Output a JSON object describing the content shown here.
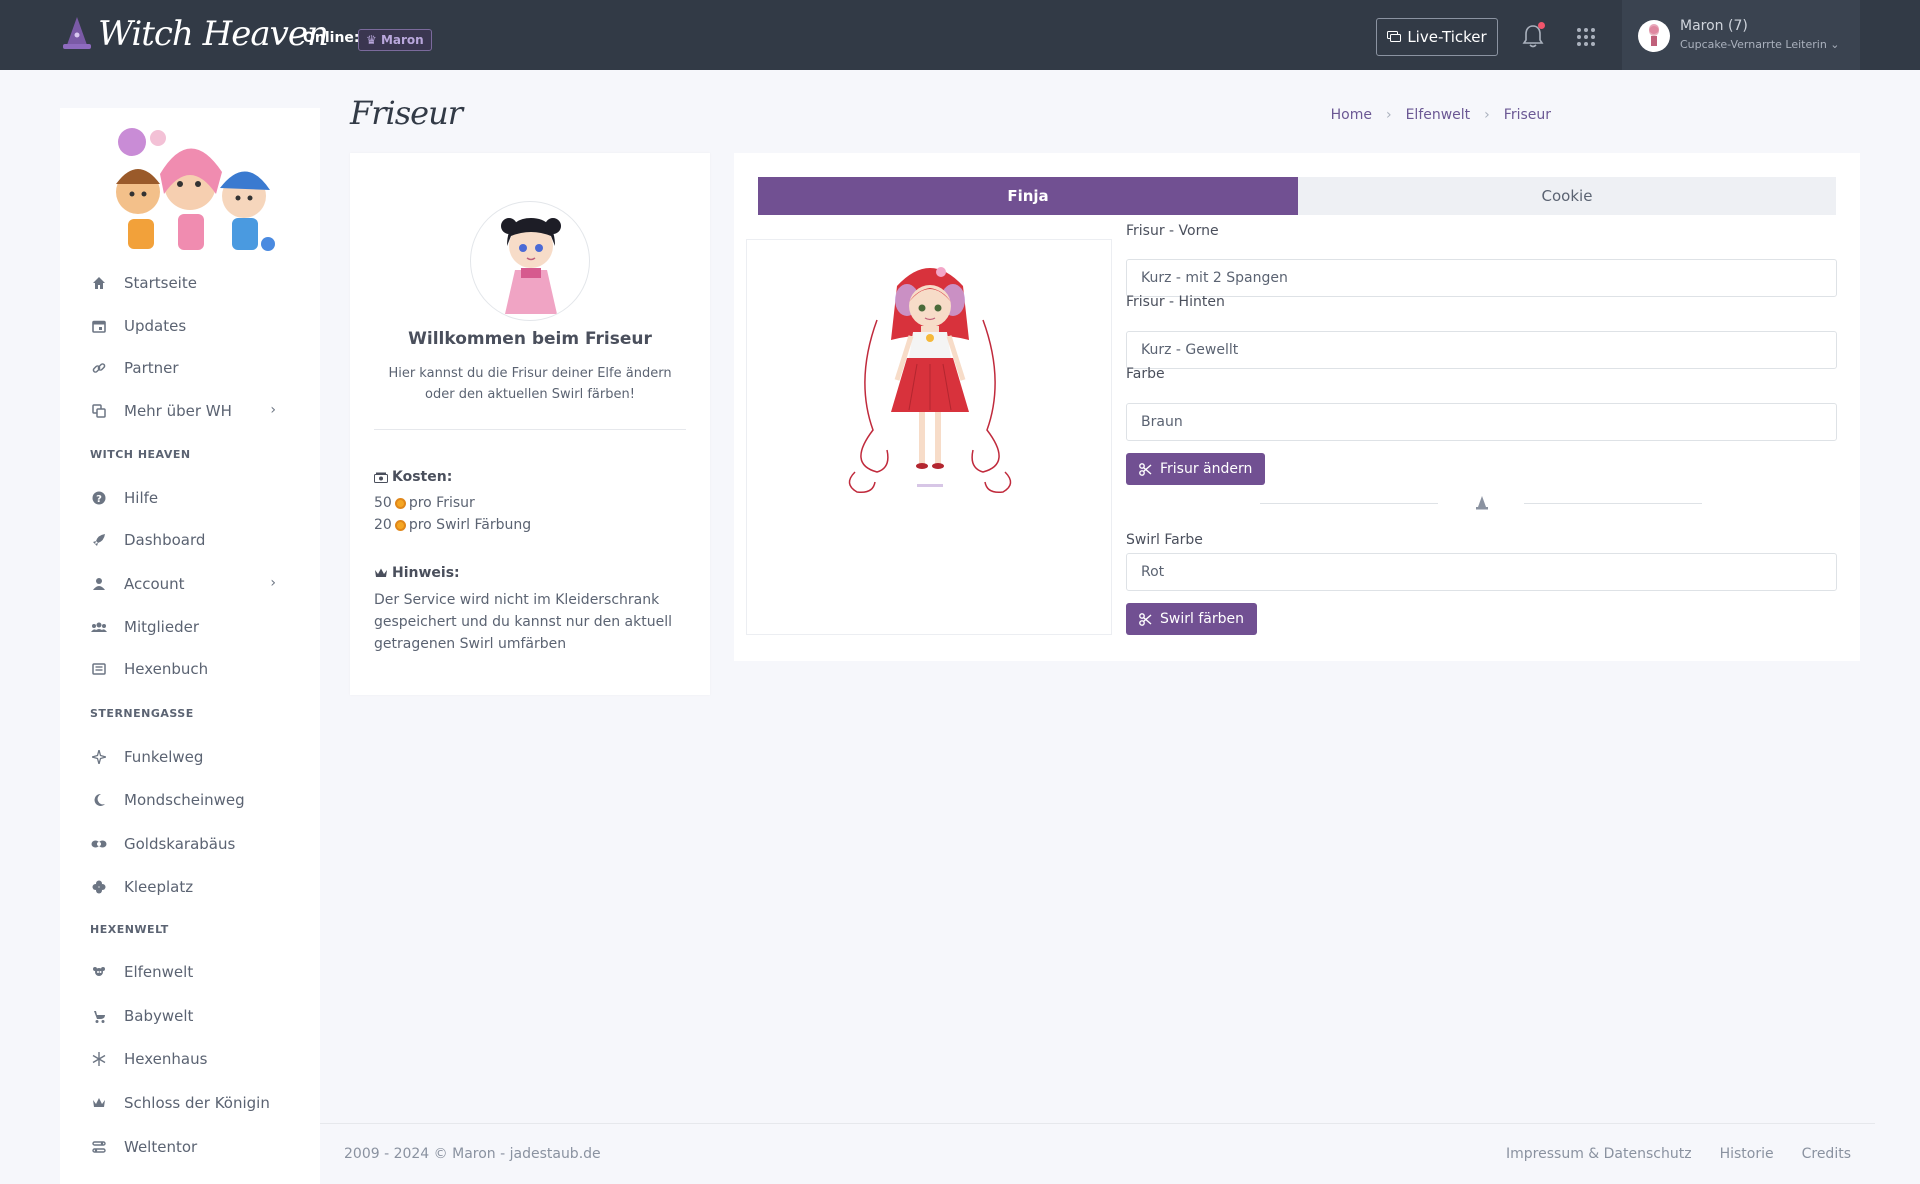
{
  "header": {
    "logo_text": "Witch Heaven",
    "online_label": "Online:",
    "online_user": "Maron",
    "live_ticker_label": "Live-Ticker",
    "user_name": "Maron (7)",
    "user_role": "Cupcake-Vernarrte Leiterin"
  },
  "sidebar": {
    "items_main": [
      {
        "label": "Startseite",
        "icon": "home-icon"
      },
      {
        "label": "Updates",
        "icon": "calendar-icon"
      },
      {
        "label": "Partner",
        "icon": "link-icon"
      },
      {
        "label": "Mehr über WH",
        "icon": "copy-icon"
      }
    ],
    "section_witch_heaven": "WITCH HEAVEN",
    "items_wh": [
      {
        "label": "Hilfe",
        "icon": "help-icon"
      },
      {
        "label": "Dashboard",
        "icon": "rocket-icon"
      },
      {
        "label": "Account",
        "icon": "user-icon"
      },
      {
        "label": "Mitglieder",
        "icon": "users-icon"
      },
      {
        "label": "Hexenbuch",
        "icon": "book-icon"
      }
    ],
    "section_sternengasse": "STERNENGASSE",
    "items_sg": [
      {
        "label": "Funkelweg",
        "icon": "sparkle-icon"
      },
      {
        "label": "Mondscheinweg",
        "icon": "moon-icon"
      },
      {
        "label": "Goldskarabäus",
        "icon": "scarab-icon"
      },
      {
        "label": "Kleeplatz",
        "icon": "clover-icon"
      }
    ],
    "section_hexenwelt": "HEXENWELT",
    "items_hw": [
      {
        "label": "Elfenwelt",
        "icon": "fairy-icon"
      },
      {
        "label": "Babywelt",
        "icon": "stroller-icon"
      },
      {
        "label": "Hexenhaus",
        "icon": "snowflake-icon"
      },
      {
        "label": "Schloss der Königin",
        "icon": "crown-icon"
      },
      {
        "label": "Weltentor",
        "icon": "portal-icon"
      }
    ]
  },
  "page": {
    "title": "Friseur",
    "breadcrumb": [
      "Home",
      "Elfenwelt",
      "Friseur"
    ]
  },
  "info": {
    "welcome_title": "Willkommen beim Friseur",
    "welcome_text": "Hier kannst du die Frisur deiner Elfe ändern oder den aktuellen Swirl färben!",
    "cost_label": "Kosten:",
    "cost_hair_amount": "50",
    "cost_hair_text": "pro Frisur",
    "cost_swirl_amount": "20",
    "cost_swirl_text": "pro Swirl Färbung",
    "hint_label": "Hinweis:",
    "hint_text": "Der Service wird nicht im Kleiderschrank gespeichert und du kannst nur den aktuell getragenen Swirl umfärben"
  },
  "tabs": [
    "Finja",
    "Cookie"
  ],
  "form": {
    "front_label": "Frisur - Vorne",
    "front_value": "Kurz - mit 2 Spangen",
    "back_label": "Frisur - Hinten",
    "back_value": "Kurz - Gewellt",
    "color_label": "Farbe",
    "color_value": "Braun",
    "change_button": "Frisur ändern",
    "swirl_label": "Swirl Farbe",
    "swirl_value": "Rot",
    "swirl_button": "Swirl färben"
  },
  "footer": {
    "copyright": "2009 - 2024 © Maron - jadestaub.de",
    "links": [
      "Impressum & Datenschutz",
      "Historie",
      "Credits"
    ]
  },
  "colors": {
    "accent": "#715092",
    "topbar": "#323a46",
    "background": "#f6f7fb"
  }
}
